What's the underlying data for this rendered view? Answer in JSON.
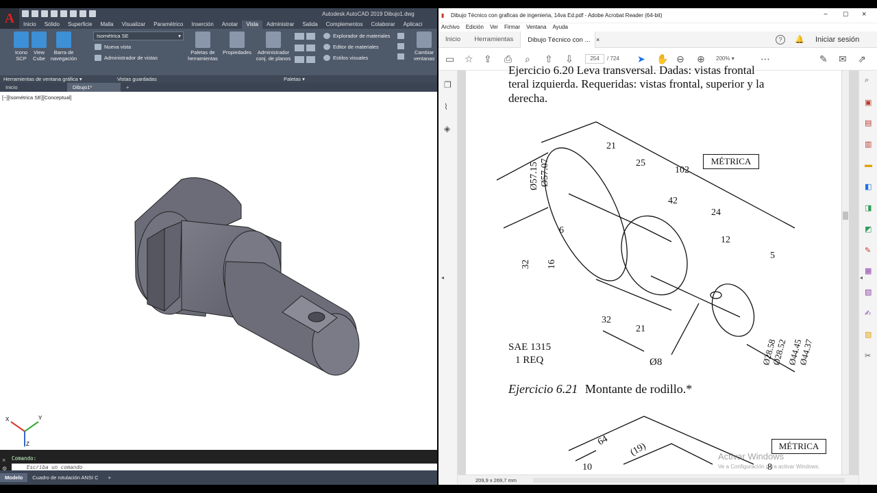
{
  "autocad": {
    "title": "Autodesk AutoCAD 2019    Dibujo1.dwg",
    "ribbon_tabs": [
      "Inicio",
      "Sólido",
      "Superficie",
      "Malla",
      "Visualizar",
      "Paramétrico",
      "Inserción",
      "Anotar",
      "Vista",
      "Administrar",
      "Salida",
      "Complementos",
      "Colaborar",
      "Aplicaci"
    ],
    "active_tab": "Vista",
    "buttons": {
      "icono_scp": "Icono SCP",
      "view_cube": "View Cube",
      "barra_nav": "Barra de navegación",
      "view_select": "Isométrica SE",
      "nueva_vista": "Nueva vista",
      "admin_vistas": "Administrador de vistas",
      "paletas_herr": "Paletas de herramientas",
      "propiedades": "Propiedades",
      "admin_planos": "Administrador conj. de planos",
      "explorador_mat": "Explorador de materiales",
      "editor_mat": "Editor de materiales",
      "estilos_vis": "Estilos visuales",
      "cambiar_ventanas": "Cambiar ventanas"
    },
    "panel_labels": {
      "herramientas": "Herramientas de ventana gráfica ▾",
      "vistas_guardadas": "Vistas guardadas",
      "paletas": "Paletas ▾"
    },
    "doc_tabs": [
      "Inicio",
      "Dibujo1*"
    ],
    "viewport_label": "[−][Isométrica SE][Conceptual]",
    "command_history": "Comando:",
    "command_placeholder": "Escriba un comando",
    "layout_tabs": [
      "Modelo",
      "Cuadro de rotulación ANSI C"
    ],
    "ucs": {
      "x": "X",
      "y": "Y",
      "z": "Z"
    }
  },
  "acrobat": {
    "title": "Dibujo Técnico con graficas de ingenieria, 14va Ed.pdf - Adobe Acrobat Reader (64-bit)",
    "menu": [
      "Archivo",
      "Edición",
      "Ver",
      "Firmar",
      "Ventana",
      "Ayuda"
    ],
    "tabs": [
      "Inicio",
      "Herramientas",
      "Dibujo Técnico con ..."
    ],
    "sign_in": "Iniciar sesión",
    "page_current": "254",
    "page_total": "/ 724",
    "zoom": "200%",
    "page_size": "209,9 x 269,7 mm",
    "content": {
      "line0": "Ejercicio 6.20  Leva transversal. Dadas: vistas frontal",
      "line1": "teral izquierda. Requeridas: vistas frontal, superior y la",
      "line2": "derecha.",
      "metrica1": "MÉTRICA",
      "sae": "SAE 1315",
      "req": "1 REQ",
      "dims": [
        "21",
        "25",
        "102",
        "42",
        "24",
        "12",
        "5",
        "Ø57.15",
        "Ø57.07",
        "6",
        "32",
        "16",
        "32",
        "21",
        "Ø8",
        "Ø28.58",
        "Ø28.52",
        "Ø44.45",
        "Ø44.37"
      ],
      "ex_num": "Ejercicio 6.21",
      "ex_title": "Montante de rodillo.*",
      "metrica2": "MÉTRICA",
      "dims2": [
        "64",
        "(19)",
        "10",
        "8"
      ]
    },
    "watermark1": "Activar Windows",
    "watermark2": "Ve a Configuración para activar Windows."
  }
}
